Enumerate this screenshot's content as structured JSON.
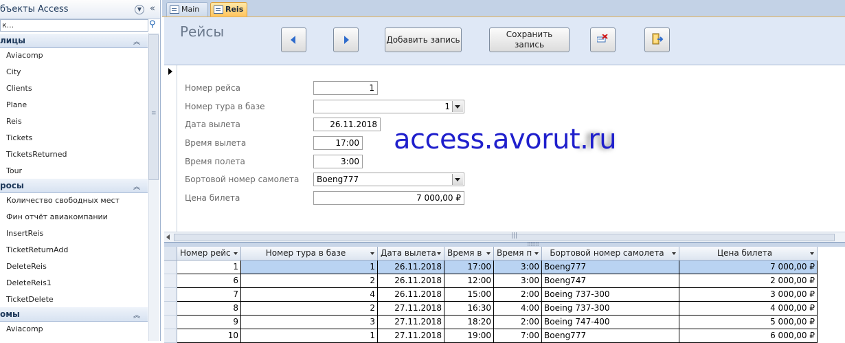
{
  "nav": {
    "title": "бъекты Access",
    "search_value": "к...",
    "groups": [
      {
        "label": "лицы",
        "items": [
          "Aviacomp",
          "City",
          "Clients",
          "Plane",
          "Reis",
          "Tickets",
          "TicketsReturned",
          "Tour"
        ]
      },
      {
        "label": "росы",
        "items": [
          "Количество свободных мест",
          "Фин отчёт авиакомпании",
          "InsertReis",
          "TicketReturnAdd",
          "DeleteReis",
          "DeleteReis1",
          "TicketDelete"
        ]
      },
      {
        "label": "омы",
        "items": [
          "Aviacomp"
        ]
      }
    ]
  },
  "tabs": [
    {
      "label": "Main",
      "active": false
    },
    {
      "label": "Reis",
      "active": true
    }
  ],
  "form": {
    "title": "Рейсы",
    "buttons": {
      "add": "Добавить запись",
      "save": "Сохранить запись"
    },
    "fields": [
      {
        "label": "Номер рейса",
        "value": "1"
      },
      {
        "label": "Номер тура в базе",
        "value": "1"
      },
      {
        "label": "Дата вылета",
        "value": "26.11.2018"
      },
      {
        "label": "Время вылета",
        "value": "17:00"
      },
      {
        "label": "Время полета",
        "value": "3:00"
      },
      {
        "label": "Бортовой номер самолета",
        "value": "Boeng777"
      },
      {
        "label": "Цена билета",
        "value": "7 000,00 ₽"
      }
    ],
    "watermark": "access.avorut.ru",
    "watermark_ghost": ".ru"
  },
  "datasheet": {
    "columns": [
      "Номер рейс",
      "Номер тура в базе",
      "Дата вылета",
      "Время в",
      "Время п",
      "Бортовой номер самолета",
      "Цена билета"
    ],
    "rows": [
      [
        "1",
        "1",
        "26.11.2018",
        "17:00",
        "3:00",
        "Boeng777",
        "7 000,00 ₽"
      ],
      [
        "6",
        "2",
        "26.11.2018",
        "12:00",
        "3:00",
        "Boeng747",
        "2 000,00 ₽"
      ],
      [
        "7",
        "4",
        "26.11.2018",
        "15:00",
        "2:00",
        "Boeing 737-300",
        "3 000,00 ₽"
      ],
      [
        "8",
        "2",
        "27.11.2018",
        "16:30",
        "4:00",
        "Boeing 737-300",
        "4 000,00 ₽"
      ],
      [
        "9",
        "3",
        "27.11.2018",
        "18:20",
        "2:00",
        "Boeing 747-400",
        "5 000,00 ₽"
      ],
      [
        "10",
        "1",
        "27.11.2018",
        "19:00",
        "7:00",
        "Boeng777",
        "6 000,00 ₽"
      ]
    ]
  },
  "colors": {
    "accent_tab": "#ffc45e",
    "header_bg": "#dfe8f6",
    "selected_row": "#b9d3f2",
    "watermark": "#1f1fcc"
  }
}
